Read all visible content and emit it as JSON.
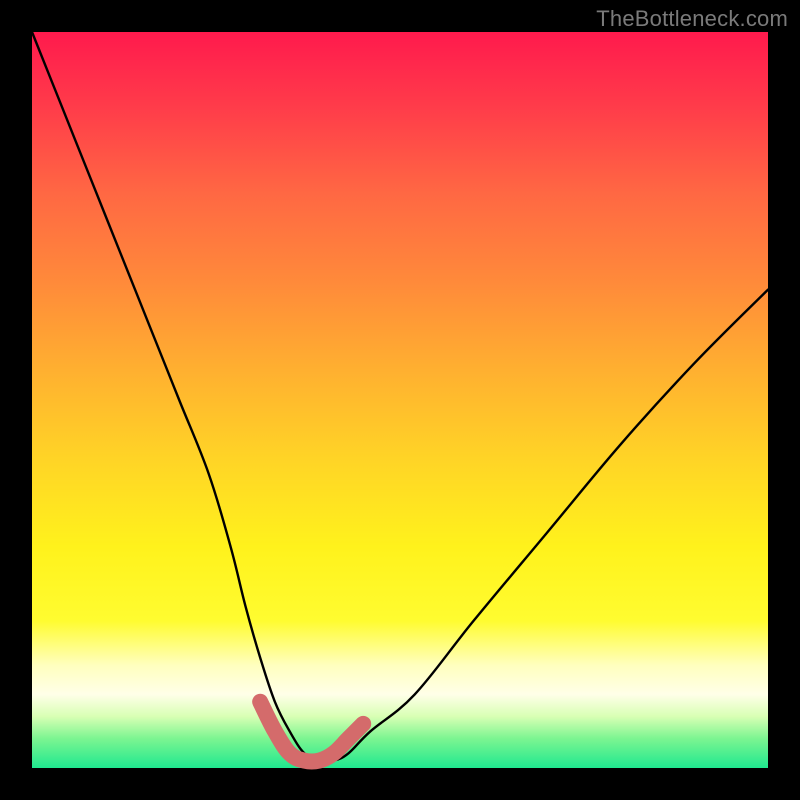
{
  "watermark": "TheBottleneck.com",
  "colors": {
    "frame": "#000000",
    "curve": "#000000",
    "marker": "#d46b6b"
  },
  "chart_data": {
    "type": "line",
    "title": "",
    "xlabel": "",
    "ylabel": "",
    "xlim": [
      0,
      100
    ],
    "ylim": [
      0,
      100
    ],
    "grid": false,
    "legend": false,
    "series": [
      {
        "name": "bottleneck-curve",
        "x": [
          0,
          4,
          8,
          12,
          16,
          20,
          24,
          27,
          29,
          31,
          33,
          35,
          37,
          39,
          41,
          43,
          46,
          52,
          60,
          70,
          80,
          90,
          100
        ],
        "y": [
          100,
          90,
          80,
          70,
          60,
          50,
          40,
          30,
          22,
          15,
          9,
          5,
          2,
          1,
          1,
          2,
          5,
          10,
          20,
          32,
          44,
          55,
          65
        ]
      },
      {
        "name": "valley-marker",
        "x": [
          31,
          33,
          35,
          37,
          39,
          41,
          43,
          45
        ],
        "y": [
          9,
          5,
          2,
          1,
          1,
          2,
          4,
          6
        ]
      }
    ],
    "note": "Axis values are estimated from pixel positions; the chart has no tick labels."
  }
}
